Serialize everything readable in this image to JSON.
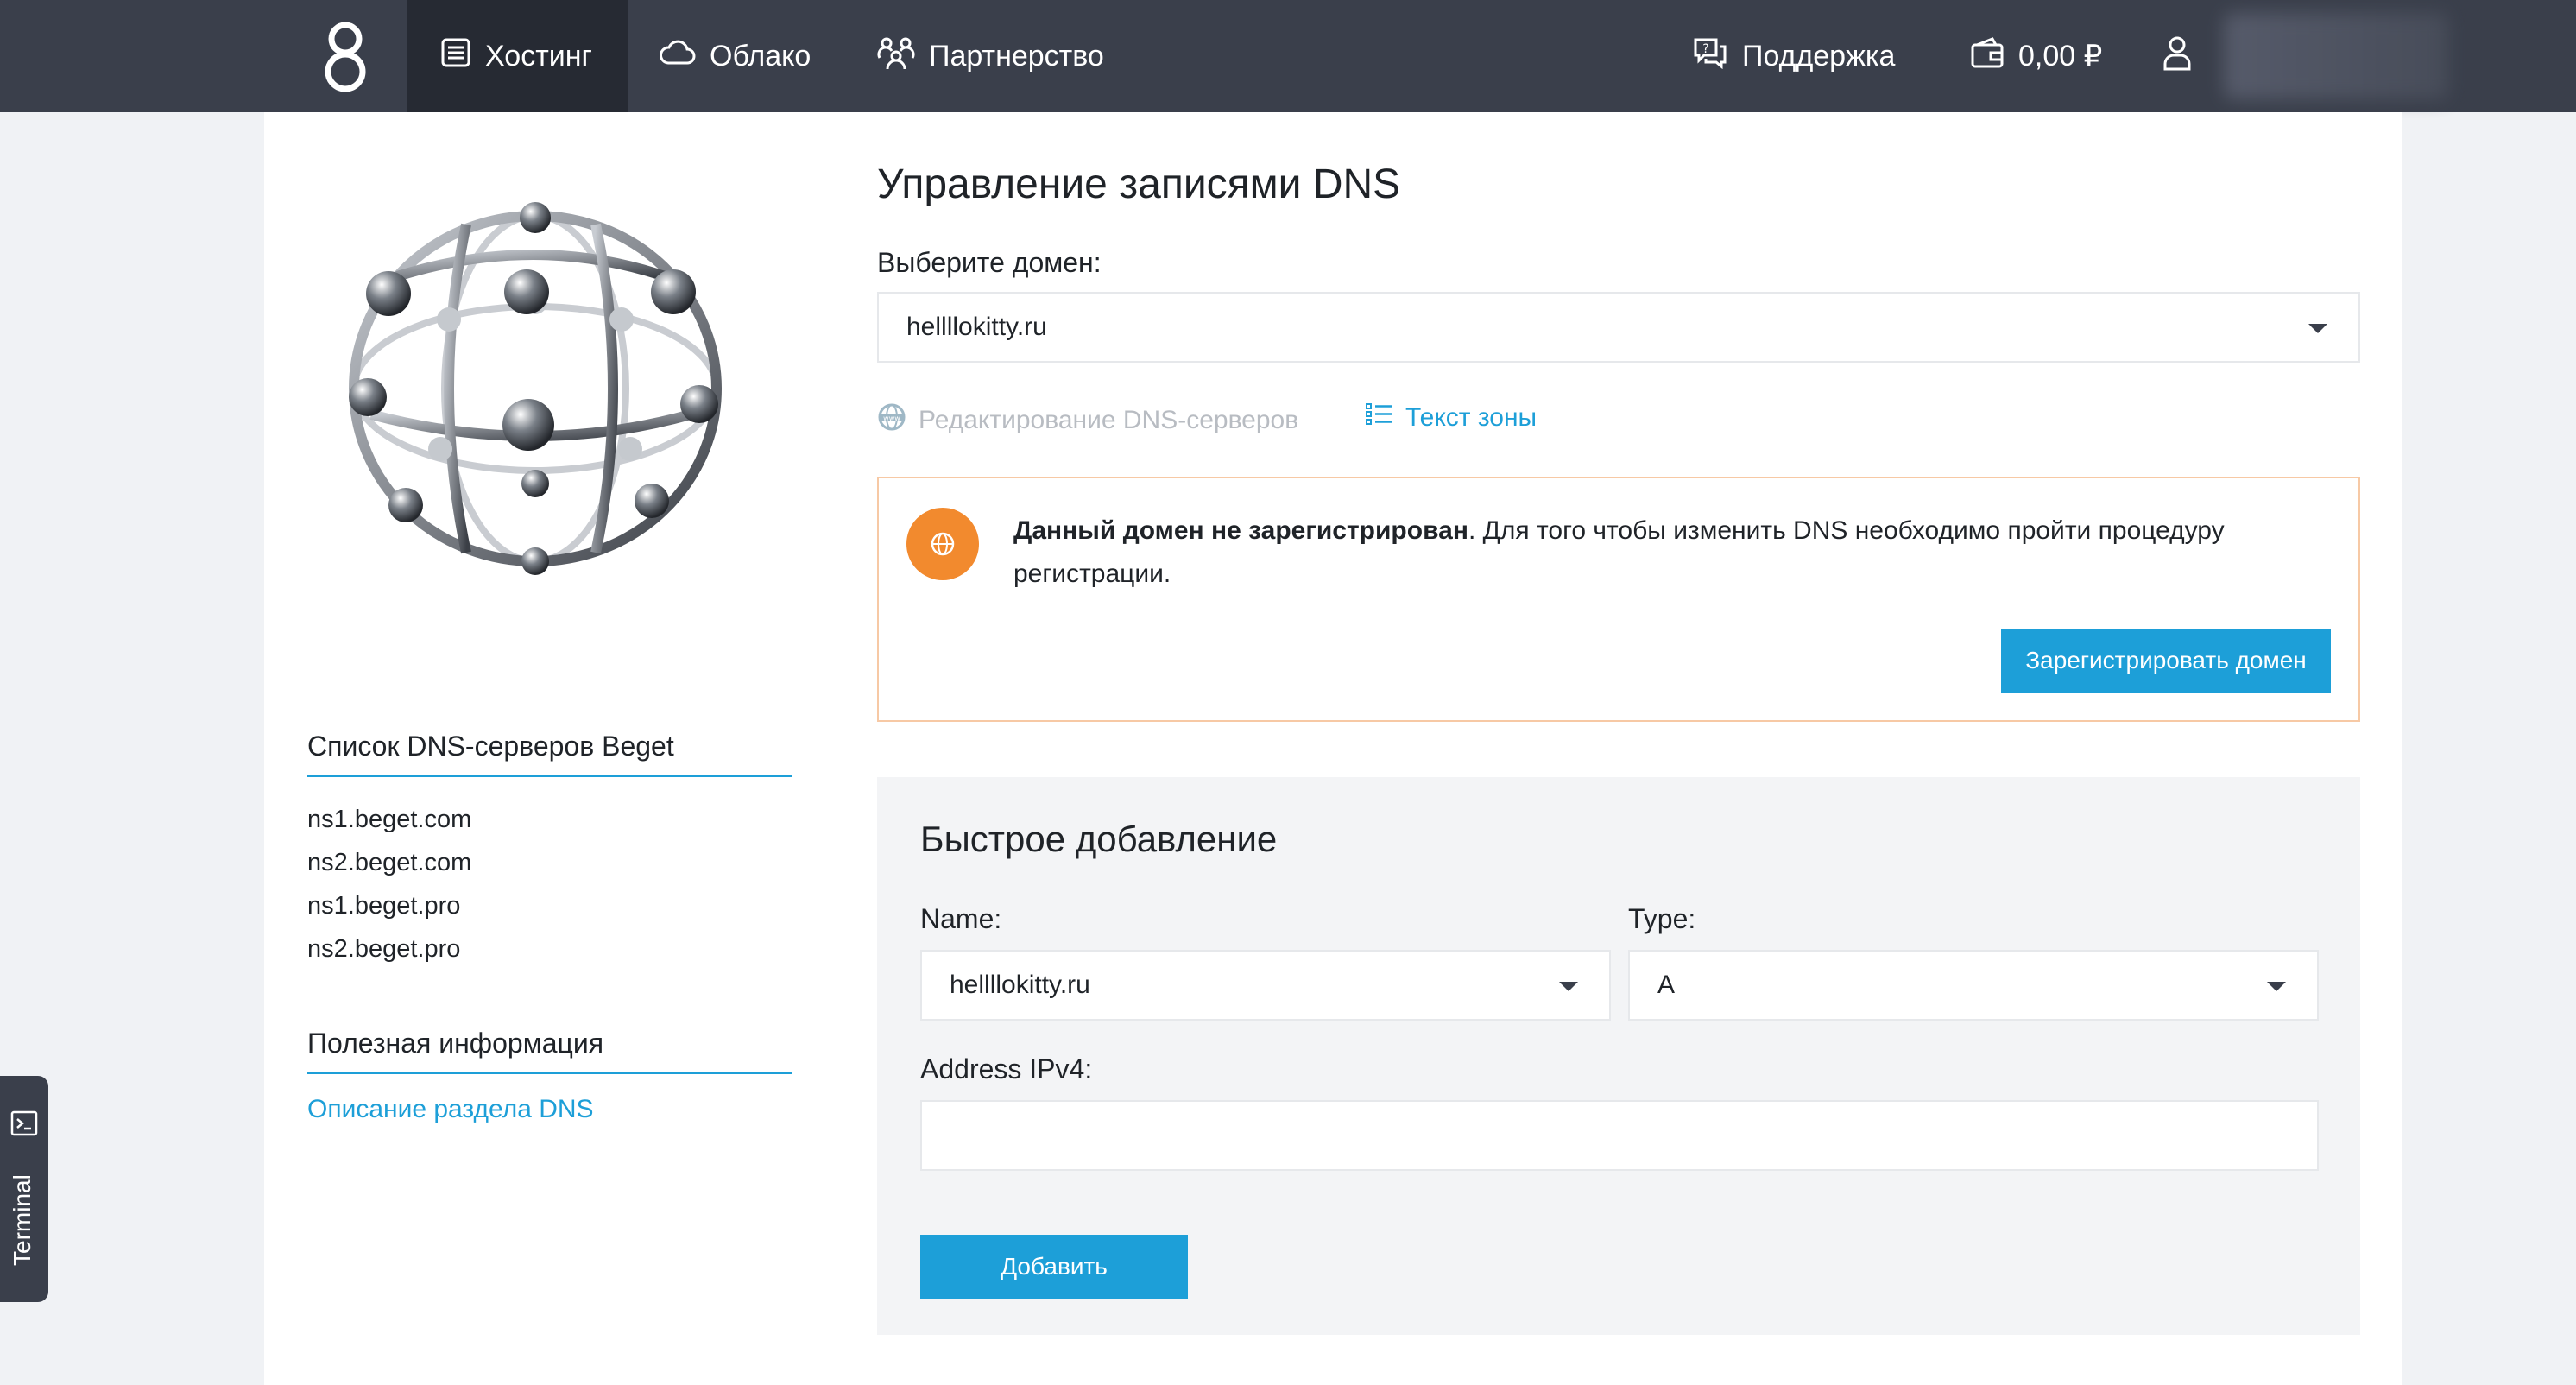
{
  "topbar": {
    "nav": [
      {
        "label": "Хостинг",
        "icon": "server-list-icon",
        "active": true
      },
      {
        "label": "Облако",
        "icon": "cloud-icon",
        "active": false
      },
      {
        "label": "Партнерство",
        "icon": "partners-icon",
        "active": false
      }
    ],
    "support_label": "Поддержка",
    "balance": "0,00 ₽"
  },
  "sidebar": {
    "dns_servers_heading": "Список DNS-серверов Beget",
    "dns_servers": [
      "ns1.beget.com",
      "ns2.beget.com",
      "ns1.beget.pro",
      "ns2.beget.pro"
    ],
    "useful_heading": "Полезная информация",
    "useful_link": "Описание раздела DNS"
  },
  "main": {
    "title": "Управление записями DNS",
    "domain_label": "Выберите домен:",
    "domain_value": "hellllokitty.ru",
    "edit_dns_link": "Редактирование DNS-серверов",
    "zone_text_link": "Текст зоны",
    "alert": {
      "bold": "Данный домен не зарегистрирован",
      "text": ". Для того чтобы изменить DNS необходимо пройти процедуру регистрации.",
      "button": "Зарегистрировать домен",
      "color": "#f28a2e"
    },
    "quick_add": {
      "title": "Быстрое добавление",
      "name_label": "Name:",
      "name_value": "hellllokitty.ru",
      "type_label": "Type:",
      "type_value": "A",
      "address_label": "Address IPv4:",
      "address_value": "",
      "add_button": "Добавить"
    }
  },
  "terminal": {
    "label": "Terminal"
  },
  "colors": {
    "accent": "#1d9fd8",
    "topbar": "#3a3f4b",
    "warning": "#f28a2e"
  }
}
